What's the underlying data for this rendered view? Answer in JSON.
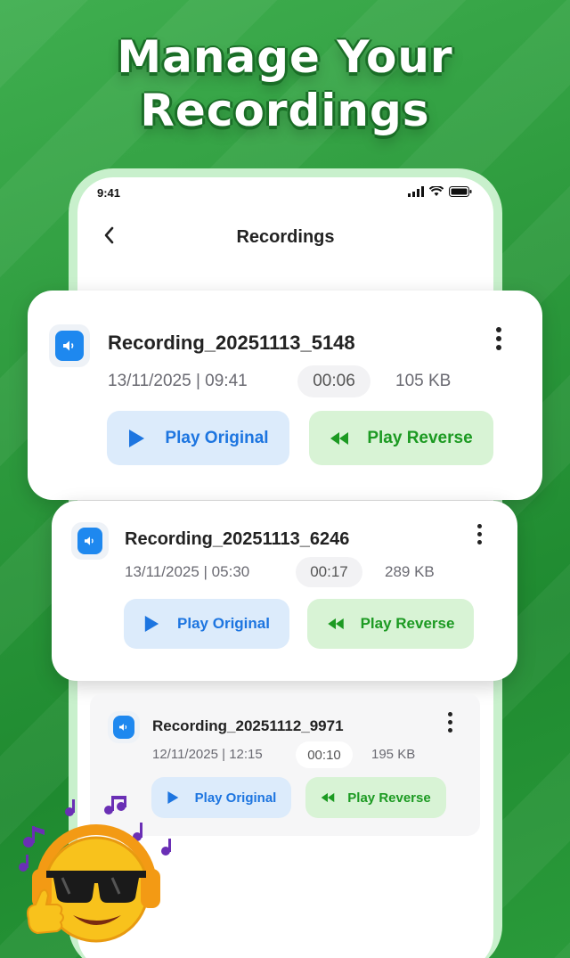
{
  "headline": {
    "line1": "Manage Your",
    "line2": "Recordings"
  },
  "status_bar": {
    "time": "9:41",
    "icons": [
      "signal-icon",
      "wifi-icon",
      "battery-icon"
    ]
  },
  "nav": {
    "back_icon": "chevron-left-icon",
    "title": "Recordings"
  },
  "recordings": [
    {
      "name": "Recording_20251113_5148",
      "date": "13/11/2025 | 09:41",
      "duration": "00:06",
      "size": "105 KB",
      "play_original": "Play Original",
      "play_reverse": "Play Reverse"
    },
    {
      "name": "Recording_20251113_6246",
      "date": "13/11/2025 | 05:30",
      "duration": "00:17",
      "size": "289 KB",
      "play_original": "Play Original",
      "play_reverse": "Play Reverse"
    },
    {
      "name": "Recording_20251112_9971",
      "date": "12/11/2025 | 12:15",
      "duration": "00:10",
      "size": "195 KB",
      "play_original": "Play Original",
      "play_reverse": "Play Reverse"
    }
  ],
  "colors": {
    "accent_blue": "#1e88ef",
    "accent_green": "#1c9a22",
    "background_green": "#2e9b3e"
  },
  "decoration": {
    "mascot": "emoji-with-sunglasses-and-headphones"
  }
}
